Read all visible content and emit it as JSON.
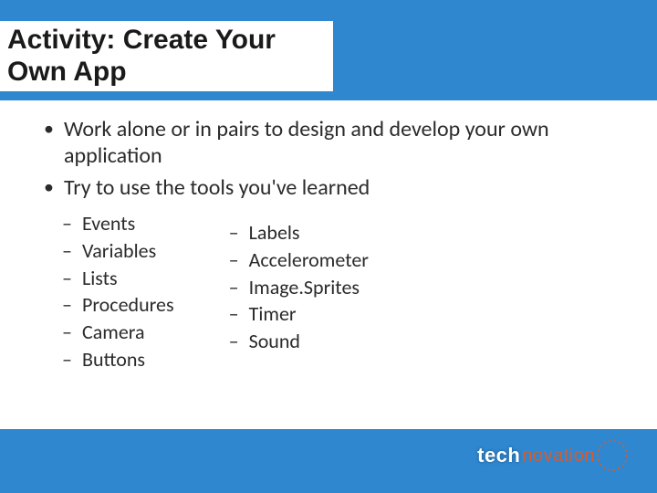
{
  "title": "Activity: Create Your Own App",
  "bullets": [
    "Work alone or in pairs to design and develop your own application",
    "Try to use the tools you've learned"
  ],
  "sub_left": [
    "Events",
    "Variables",
    "Lists",
    "Procedures",
    "Camera",
    "Buttons"
  ],
  "sub_right": [
    "Labels",
    "Accelerometer",
    "Image.Sprites",
    "Timer",
    "Sound"
  ],
  "logo": {
    "part1": "tech",
    "part2": "novation"
  },
  "colors": {
    "band": "#2f87d0",
    "accent": "#d95b2a"
  }
}
